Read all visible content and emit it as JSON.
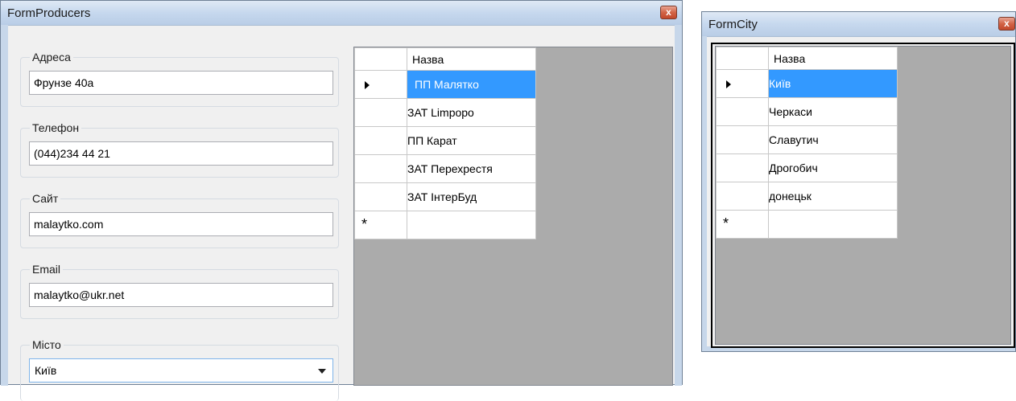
{
  "producers": {
    "title": "FormProducers",
    "close_glyph": "x",
    "fields": {
      "address": {
        "label": "Адреса",
        "value": "Фрунзе 40а"
      },
      "phone": {
        "label": "Телефон",
        "value": "(044)234 44 21"
      },
      "site": {
        "label": "Сайт",
        "value": "malaytko.com"
      },
      "email": {
        "label": "Email",
        "value": "malaytko@ukr.net"
      },
      "city": {
        "label": "Місто",
        "value": "Київ"
      }
    },
    "grid": {
      "header": "Назва",
      "rows": [
        "ПП Малятко",
        "ЗАТ Limpopo",
        "ПП Карат",
        "ЗАТ Перехрестя",
        "ЗАТ ІнтерБуд"
      ],
      "new_row_marker": "*"
    }
  },
  "city": {
    "title": "FormCity",
    "close_glyph": "x",
    "grid": {
      "header": "Назва",
      "rows": [
        "Київ",
        "Черкаси",
        "Славутич",
        "Дрогобич",
        "донецьк"
      ],
      "new_row_marker": "*"
    }
  },
  "colors": {
    "selection": "#3399ff",
    "grid_background": "#ababab",
    "title_gradient": "#c6d8ee"
  }
}
